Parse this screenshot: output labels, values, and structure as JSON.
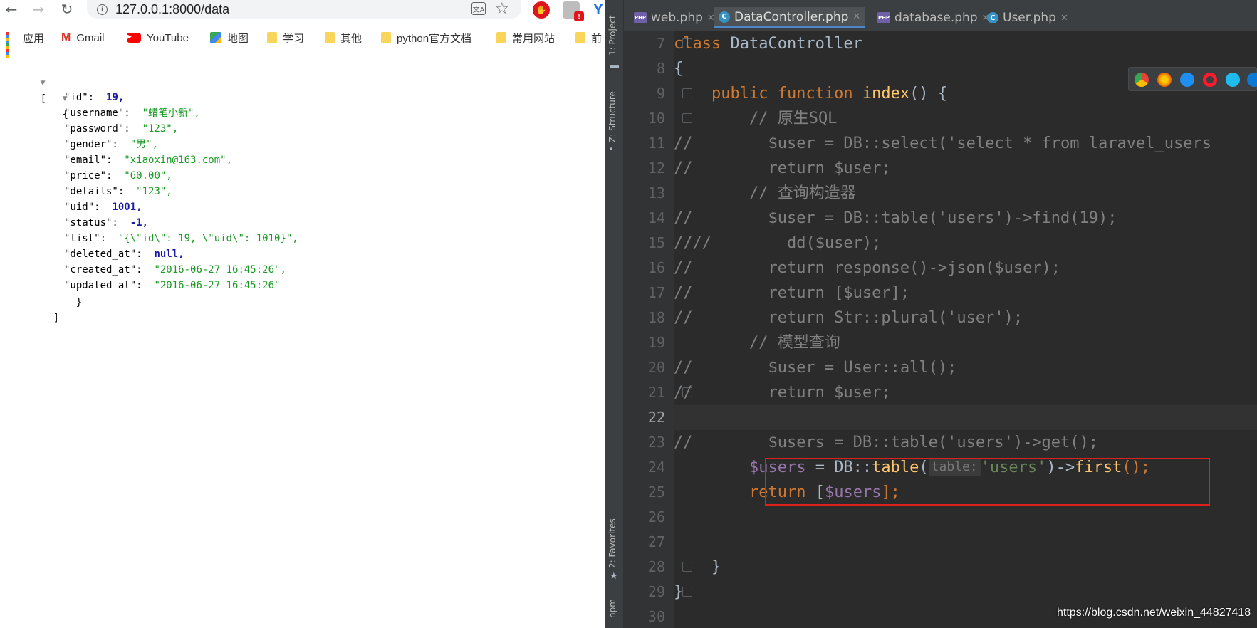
{
  "browser": {
    "url": "127.0.0.1:8000/data",
    "bookmarks": [
      {
        "label": "应用",
        "icon": "apps-grid-icon"
      },
      {
        "label": "Gmail",
        "icon": "gmail-icon"
      },
      {
        "label": "YouTube",
        "icon": "youtube-icon"
      },
      {
        "label": "地图",
        "icon": "maps-icon"
      },
      {
        "label": "学习",
        "icon": "folder-icon"
      },
      {
        "label": "其他",
        "icon": "folder-icon"
      },
      {
        "label": "python官方文档",
        "icon": "folder-icon"
      },
      {
        "label": "常用网站",
        "icon": "folder-icon"
      },
      {
        "label": "前",
        "icon": "folder-icon"
      }
    ],
    "json_view": {
      "open_bracket": "[",
      "open_brace": "{",
      "close_brace": "}",
      "close_bracket": "]",
      "rows": [
        {
          "key": "\"id\":",
          "value": "19,",
          "type": "number"
        },
        {
          "key": "\"username\":",
          "value": "\"蜡笔小新\",",
          "type": "string"
        },
        {
          "key": "\"password\":",
          "value": "\"123\",",
          "type": "string"
        },
        {
          "key": "\"gender\":",
          "value": "\"男\",",
          "type": "string"
        },
        {
          "key": "\"email\":",
          "value": "\"xiaoxin@163.com\",",
          "type": "string"
        },
        {
          "key": "\"price\":",
          "value": "\"60.00\",",
          "type": "string"
        },
        {
          "key": "\"details\":",
          "value": "\"123\",",
          "type": "string"
        },
        {
          "key": "\"uid\":",
          "value": "1001,",
          "type": "number"
        },
        {
          "key": "\"status\":",
          "value": "-1,",
          "type": "number"
        },
        {
          "key": "\"list\":",
          "value": "\"{\\\"id\\\": 19, \\\"uid\\\": 1010}\",",
          "type": "string"
        },
        {
          "key": "\"deleted_at\":",
          "value": "null,",
          "type": "null"
        },
        {
          "key": "\"created_at\":",
          "value": "\"2016-06-27 16:45:26\",",
          "type": "string"
        },
        {
          "key": "\"updated_at\":",
          "value": "\"2016-06-27 16:45:26\"",
          "type": "string"
        }
      ]
    }
  },
  "ide": {
    "side_labels": {
      "project": "1: Project",
      "structure": "Z: Structure",
      "favorites": "2: Favorites",
      "npm": "npm"
    },
    "tabs": [
      {
        "label": "web.php",
        "icon": "php"
      },
      {
        "label": "DataController.php",
        "icon": "class",
        "active": true
      },
      {
        "label": "database.php",
        "icon": "php"
      },
      {
        "label": "User.php",
        "icon": "class"
      }
    ],
    "line_numbers": [
      "7",
      "8",
      "9",
      "10",
      "11",
      "12",
      "13",
      "14",
      "15",
      "16",
      "17",
      "18",
      "19",
      "20",
      "21",
      "22",
      "23",
      "24",
      "25",
      "26",
      "27",
      "28",
      "29",
      "30"
    ],
    "current_line": "22",
    "code": {
      "l7a": "class",
      "l7b": " DataController",
      "l8": "{",
      "l9a": "    public function ",
      "l9b": "index",
      "l9c": "() {",
      "l10": "        // 原生SQL",
      "l11a": "//        ",
      "l11b": "$user = DB::select('select * from laravel_users",
      "l12a": "//        ",
      "l12b": "return $user;",
      "l13": "        // 查询构造器",
      "l14a": "//        ",
      "l14b": "$user = DB::table('users')->find(19);",
      "l15a": "////        ",
      "l15b": "dd($user);",
      "l16a": "//        ",
      "l16b": "return response()->json($user);",
      "l17a": "//        ",
      "l17b": "return [$user];",
      "l18a": "//        ",
      "l18b": "return Str::plural('user');",
      "l19": "        // 模型查询",
      "l20a": "//        ",
      "l20b": "$user = User::all();",
      "l21a": "//        ",
      "l21b": "return $user;",
      "l23a": "//        ",
      "l23b": "$users = DB::table('users')->get();",
      "l24_var": "$users",
      "l24_eq": " = DB::",
      "l24_fn": "table",
      "l24_open": "(",
      "l24_hint": "table:",
      "l24_str": "'users'",
      "l24_arrow": ")->",
      "l24_first": "first",
      "l24_end": "();",
      "l25_kw": "return",
      "l25_open": " [",
      "l25_var": "$users",
      "l25_close": "];",
      "l28": "    }",
      "l29": "}"
    }
  },
  "watermark": "https://blog.csdn.net/weixin_44827418",
  "colors": {
    "ide_bg": "#2b2b2b",
    "keyword": "#cc7832",
    "function": "#ffc66d",
    "comment": "#808080",
    "variable": "#9876aa",
    "string": "#6a8759",
    "highlight_box": "#e0201c"
  }
}
